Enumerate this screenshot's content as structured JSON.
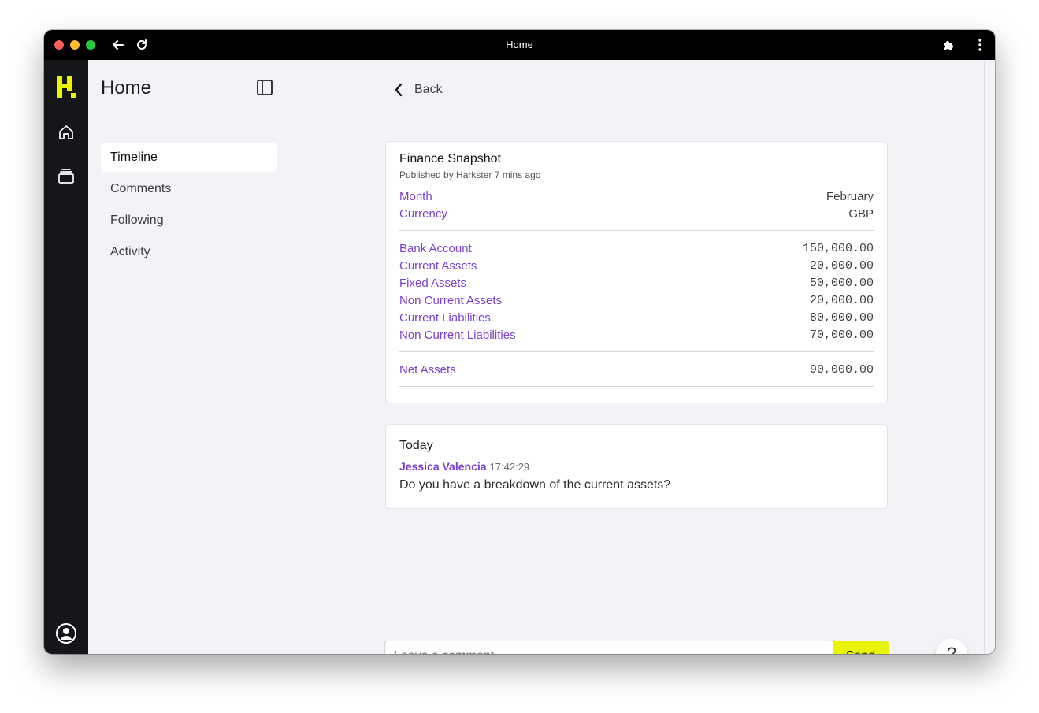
{
  "browser": {
    "title": "Home",
    "icons": {
      "back": "arrow-left-icon",
      "reload": "reload-icon",
      "extensions": "puzzle-icon",
      "menu": "kebab-menu-icon"
    }
  },
  "rail": {
    "logo_text": "H",
    "accent": "#e9f500",
    "icons": [
      "home-icon",
      "stack-icon",
      "user-circle-icon"
    ]
  },
  "subnav": {
    "title": "Home",
    "items": [
      {
        "label": "Timeline",
        "active": true
      },
      {
        "label": "Comments",
        "active": false
      },
      {
        "label": "Following",
        "active": false
      },
      {
        "label": "Activity",
        "active": false
      }
    ]
  },
  "main": {
    "back_label": "Back",
    "snapshot": {
      "title": "Finance Snapshot",
      "subtitle": "Published by Harkster 7 mins ago",
      "meta": [
        {
          "label": "Month",
          "value": "February"
        },
        {
          "label": "Currency",
          "value": "GBP"
        }
      ],
      "lines": [
        {
          "label": "Bank Account",
          "value": "150,000.00"
        },
        {
          "label": "Current Assets",
          "value": "20,000.00"
        },
        {
          "label": "Fixed Assets",
          "value": "50,000.00"
        },
        {
          "label": "Non Current Assets",
          "value": "20,000.00"
        },
        {
          "label": "Current Liabilities",
          "value": "80,000.00"
        },
        {
          "label": "Non Current Liabilities",
          "value": "70,000.00"
        }
      ],
      "total": {
        "label": "Net Assets",
        "value": "90,000.00"
      }
    },
    "comments": {
      "day": "Today",
      "items": [
        {
          "author": "Jessica Valencia",
          "time": "17:42:29",
          "text": "Do you have a breakdown of the current assets?"
        }
      ]
    },
    "composer": {
      "placeholder": "Leave a comment",
      "send_label": "Send"
    },
    "help_label": "?"
  },
  "colors": {
    "label": "#7a3fd1",
    "send": "#e9f500",
    "rail": "#15161a"
  }
}
